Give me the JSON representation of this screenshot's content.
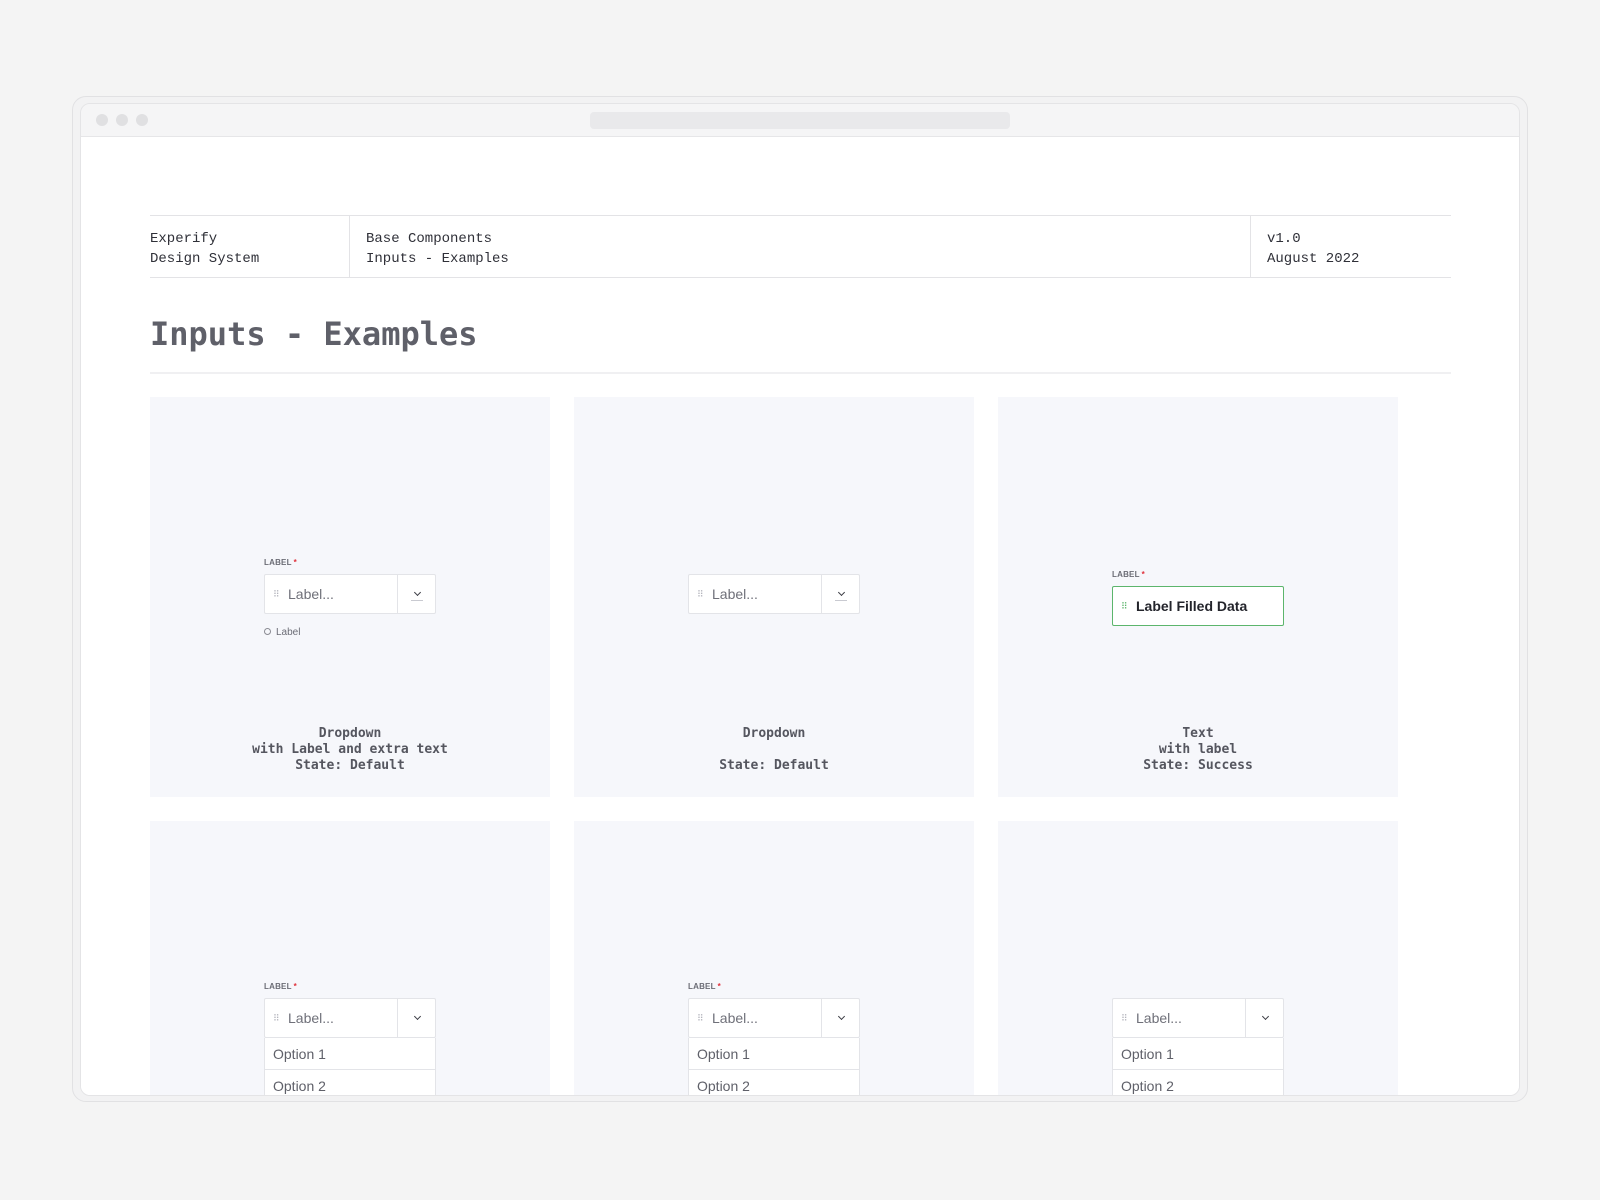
{
  "header": {
    "brand_line1": "Experify",
    "brand_line2": "Design System",
    "section_line1": "Base Components",
    "section_line2": "Inputs - Examples",
    "version": "v1.0",
    "date": "August 2022"
  },
  "page_title": "Inputs - Examples",
  "cards": [
    {
      "label": "LABEL",
      "required_mark": "*",
      "placeholder": "Label...",
      "helper": "Label",
      "caption": [
        "Dropdown",
        "with Label and extra text",
        "State: Default"
      ]
    },
    {
      "placeholder": "Label...",
      "caption": [
        "Dropdown",
        "",
        "State: Default"
      ]
    },
    {
      "label": "LABEL",
      "required_mark": "*",
      "value": "Label Filled Data",
      "caption": [
        "Text",
        "with label",
        "State: Success"
      ]
    },
    {
      "label": "LABEL",
      "required_mark": "*",
      "placeholder": "Label...",
      "options": [
        "Option 1",
        "Option 2"
      ]
    },
    {
      "label": "LABEL",
      "required_mark": "*",
      "placeholder": "Label...",
      "options": [
        "Option 1",
        "Option 2"
      ]
    },
    {
      "placeholder": "Label...",
      "options": [
        "Option 1",
        "Option 2"
      ]
    }
  ],
  "colors": {
    "success": "#5cb56c",
    "required": "#e0323c",
    "card_bg": "#f6f7fb"
  }
}
